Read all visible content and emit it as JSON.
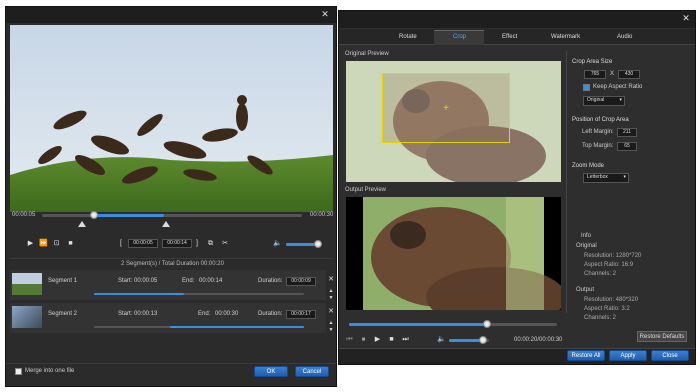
{
  "left": {
    "close_glyph": "✕",
    "time_start": "00:00:05",
    "time_end": "00:00:30",
    "seg_start": "00:00:05",
    "seg_end": "00:00:14",
    "summary": "2 Segment(s) / Total Duration 00:00:20",
    "segments": [
      {
        "name": "Segment 1",
        "start_label": "Start:",
        "start": "00:00:05",
        "end_label": "End:",
        "end": "00:00:14",
        "dur_label": "Duration:",
        "dur": "00:00:09"
      },
      {
        "name": "Segment 2",
        "start_label": "Start:",
        "start": "00:00:13",
        "end_label": "End:",
        "end": "00:00:30",
        "dur_label": "Duration:",
        "dur": "00:00:17"
      }
    ],
    "merge_label": "Merge into one file",
    "ok": "OK",
    "cancel": "Cancel"
  },
  "right": {
    "close_glyph": "✕",
    "tabs": [
      "Rotate",
      "Crop",
      "Effect",
      "Watermark",
      "Audio"
    ],
    "active_tab": "Crop",
    "original_preview": "Original Preview",
    "output_preview": "Output Preview",
    "crop_area_size": "Crop Area Size",
    "crop_w": "765",
    "crop_x": "X",
    "crop_h": "430",
    "keep_aspect": "Keep Aspect Ratio",
    "aspect_select": "Original",
    "position_title": "Position of Crop Area",
    "left_margin_label": "Left Margin:",
    "left_margin": "211",
    "top_margin_label": "Top Margin:",
    "top_margin": "65",
    "zoom_mode": "Zoom Mode",
    "zoom_select": "Letterbox",
    "info": "Info",
    "orig_title": "Original",
    "orig_res": "Resolution: 1280*720",
    "orig_ar": "Aspect Ratio: 16:9",
    "orig_ch": "Channels: 2",
    "out_title": "Output",
    "out_res": "Resolution: 480*320",
    "out_ar": "Aspect Ratio: 3:2",
    "out_ch": "Channels: 2",
    "restore_defaults": "Restore Defaults",
    "restore_all": "Restore All",
    "apply": "Apply",
    "close": "Close",
    "time": "00:00:20/00:00:30"
  }
}
